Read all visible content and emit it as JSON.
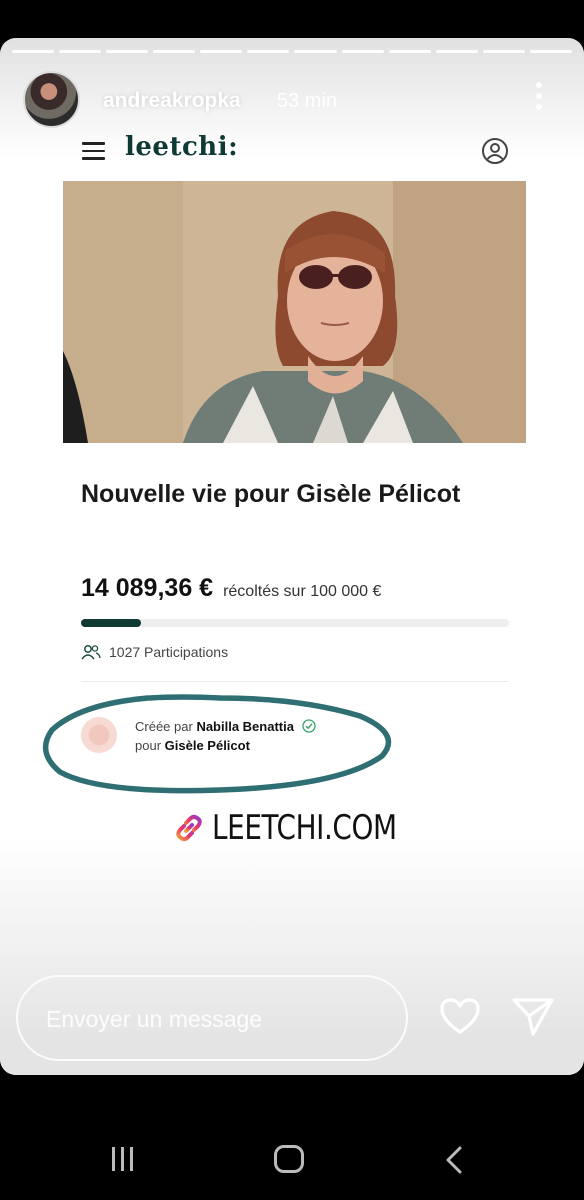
{
  "story": {
    "username": "andreakropka",
    "time": "53 min",
    "segments": 12
  },
  "leetchi": {
    "brand": "leetchi:",
    "title": "Nouvelle vie pour Gisèle Pélicot",
    "amount": "14 089,36 €",
    "amount_sub": "récoltés sur 100 000 €",
    "progress_fraction": 0.14,
    "participants": "1027 Participations",
    "creator_prefix": "Créée par",
    "creator_name": "Nabilla Benattia",
    "for_prefix": "pour",
    "beneficiary": "Gisèle Pélicot"
  },
  "link_sticker": {
    "text": "LEETCHI.COM",
    "icon": "link-icon"
  },
  "reply": {
    "placeholder": "Envoyer un message",
    "like_icon": "heart-icon",
    "send_icon": "send-icon"
  },
  "colors": {
    "brand": "#0f3a33",
    "annotation": "#2f6f73"
  }
}
